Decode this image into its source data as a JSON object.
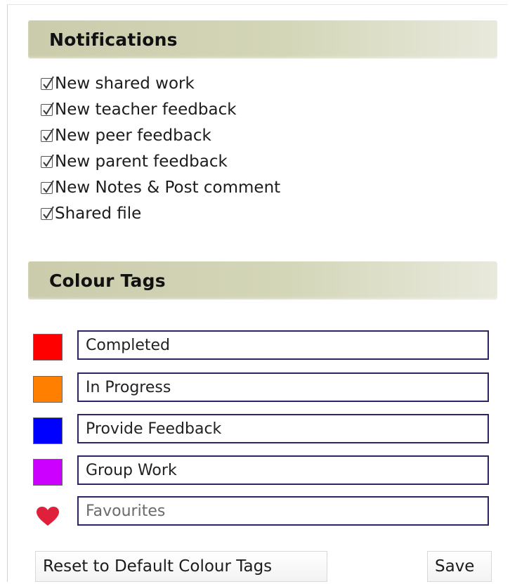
{
  "notifications": {
    "title": "Notifications",
    "items": [
      {
        "label": "New shared work",
        "checked": true
      },
      {
        "label": "New teacher feedback",
        "checked": true
      },
      {
        "label": "New peer feedback",
        "checked": true
      },
      {
        "label": "New parent feedback",
        "checked": true
      },
      {
        "label": "New Notes & Post comment",
        "checked": true
      },
      {
        "label": "Shared file",
        "checked": true
      }
    ]
  },
  "colour_tags": {
    "title": "Colour Tags",
    "tags": [
      {
        "value": "Completed",
        "color": "#ff0000",
        "icon": "red-swatch-icon"
      },
      {
        "value": "In Progress",
        "color": "#ff8000",
        "icon": "orange-swatch-icon"
      },
      {
        "value": "Provide Feedback",
        "color": "#0000ff",
        "icon": "blue-swatch-icon"
      },
      {
        "value": "Group Work",
        "color": "#cc00ff",
        "icon": "purple-swatch-icon"
      }
    ],
    "favourites": {
      "placeholder": "Favourites",
      "color": "#e0203a",
      "icon": "heart-icon"
    }
  },
  "actions": {
    "reset_label": "Reset to Default Colour Tags",
    "save_label": "Save"
  }
}
